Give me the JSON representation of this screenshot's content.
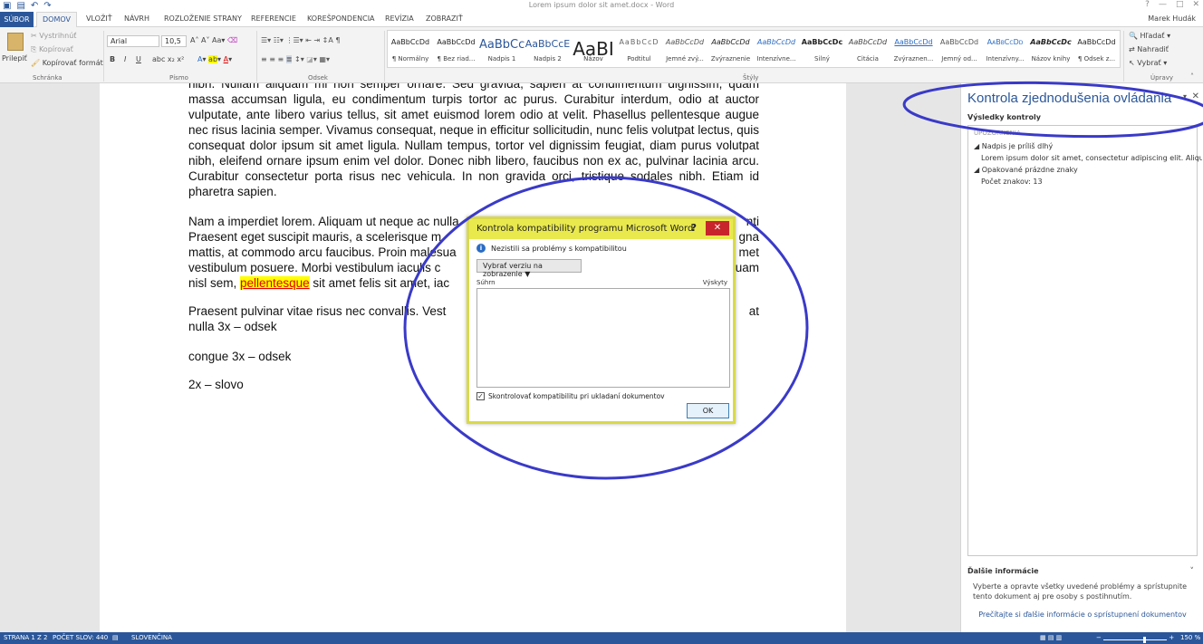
{
  "window": {
    "title": "Lorem ipsum dolor sit amet.docx - Word",
    "user": "Marek Hudák",
    "qat_icons": [
      "word-logo",
      "save",
      "undo",
      "redo"
    ]
  },
  "tabs": [
    "SÚBOR",
    "DOMOV",
    "VLOŽIŤ",
    "NÁVRH",
    "ROZLOŽENIE STRANY",
    "REFERENCIE",
    "KOREŠPONDENCIA",
    "REVÍZIA",
    "ZOBRAZIŤ"
  ],
  "ribbon": {
    "clipboard": {
      "paste": "Prilepiť",
      "cut": "Vystrihnúť",
      "copy": "Kopírovať",
      "format_painter": "Kopírovať formát",
      "group": "Schránka"
    },
    "font": {
      "family": "Arial",
      "size": "10,5",
      "group": "Písmo"
    },
    "paragraph": {
      "group": "Odsek"
    },
    "styles_group": "Štýly",
    "editing": {
      "find": "Hľadať",
      "replace": "Nahradiť",
      "select": "Vybrať",
      "group": "Úpravy"
    },
    "styles": [
      {
        "preview": "AaBbCcDd",
        "name": "¶ Normálny"
      },
      {
        "preview": "AaBbCcDd",
        "name": "¶ Bez riad..."
      },
      {
        "preview": "AaBbCc",
        "name": "Nadpis 1"
      },
      {
        "preview": "AaBbCcE",
        "name": "Nadpis 2"
      },
      {
        "preview": "AaBI",
        "name": "Názov"
      },
      {
        "preview": "AaBbCcD",
        "name": "Podtitul"
      },
      {
        "preview": "AaBbCcDd",
        "name": "Jemné zvý..."
      },
      {
        "preview": "AaBbCcDd",
        "name": "Zvýraznenie"
      },
      {
        "preview": "AaBbCcDd",
        "name": "Intenzívne..."
      },
      {
        "preview": "AaBbCcDc",
        "name": "Silný"
      },
      {
        "preview": "AaBbCcDd",
        "name": "Citácia"
      },
      {
        "preview": "AaBbCcDd",
        "name": "Zvýraznen..."
      },
      {
        "preview": "AaBbCcDd",
        "name": "Jemný od..."
      },
      {
        "preview": "AaBbCcDd",
        "name": "Intenzívny..."
      },
      {
        "preview": "AaBbCcDc",
        "name": "Názov knihy"
      },
      {
        "preview": "AaBbCcDd",
        "name": "¶ Odsek z..."
      }
    ]
  },
  "document": {
    "p1": "nibh. Nullam aliquam mi non semper ornare. Sed gravida, sapien at condimentum dignissim, quam massa accumsan ligula, eu condimentum turpis tortor ac purus. Curabitur interdum, odio at auctor vulputate, ante libero varius tellus, sit amet euismod lorem odio at velit. Phasellus pellentesque augue nec risus lacinia semper. Vivamus consequat, neque in efficitur sollicitudin, nunc felis volutpat lectus, quis consequat dolor ipsum sit amet ligula. Nullam tempus, tortor vel dignissim feugiat, diam purus volutpat nibh, eleifend ornare ipsum enim vel dolor. Donec nibh libero, faucibus non ex ac, pulvinar lacinia arcu. Curabitur consectetur porta risus nec vehicula. In non gravida orci, tristique sodales nibh. Etiam id pharetra sapien.",
    "p2a": "Nam a imperdiet lorem. Aliquam ut neque ac nulla",
    "p2b": "nti",
    "p2c": "Praesent eget suscipit mauris, a scelerisque m",
    "p2d": "gna",
    "p2e": "mattis, at commodo arcu faucibus. Proin malesua",
    "p2f": "met",
    "p2g": "vestibulum posuere. Morbi vestibulum iaculis c",
    "p2h": "uam",
    "p2i": "nisl sem,",
    "p2_highlight": "pellentesque",
    "p2j": "sit amet felis sit amet, iac",
    "p3a": "Praesent pulvinar vitae risus nec convallis. Vest",
    "p3b": "at",
    "p3c": "nulla 3x – odsek",
    "p4": "congue 3x – odsek",
    "p5": "2x – slovo"
  },
  "pane": {
    "title": "Kontrola zjednodušenia ovládania",
    "subtitle": "Výsledky kontroly",
    "section_header": "UPOZORNENIA",
    "items": [
      {
        "heading": "Nadpis je príliš dlhý",
        "detail": "Lorem ipsum dolor sit amet, consectetur adipiscing elit. Aliqua..."
      },
      {
        "heading": "Opakované prázdne znaky",
        "detail": "Počet znakov: 13"
      }
    ],
    "more_title": "Ďalšie informácie",
    "more_text": "Vyberte a opravte všetky uvedené problémy a sprístupnite tento dokument aj pre osoby s postihnutím.",
    "more_link": "Prečítajte si ďalšie informácie o sprístupnení dokumentov"
  },
  "dialog": {
    "title": "Kontrola kompatibility programu Microsoft Word",
    "message": "Nezistili sa problémy s kompatibilitou",
    "version_button": "Vybrať verziu na zobrazenie ▼",
    "summary_label": "Súhrn",
    "occurrences_label": "Výskyty",
    "checkbox_label": "Skontrolovať kompatibilitu pri ukladaní dokumentov",
    "ok": "OK"
  },
  "status": {
    "page": "STRANA 1 Z 2",
    "words": "POČET SLOV: 440",
    "language": "SLOVENČINA",
    "zoom": "150 %"
  },
  "colors": {
    "accent": "#2b579a",
    "annotation": "#3a3ac8",
    "dialog_frame": "#d9d94a"
  }
}
